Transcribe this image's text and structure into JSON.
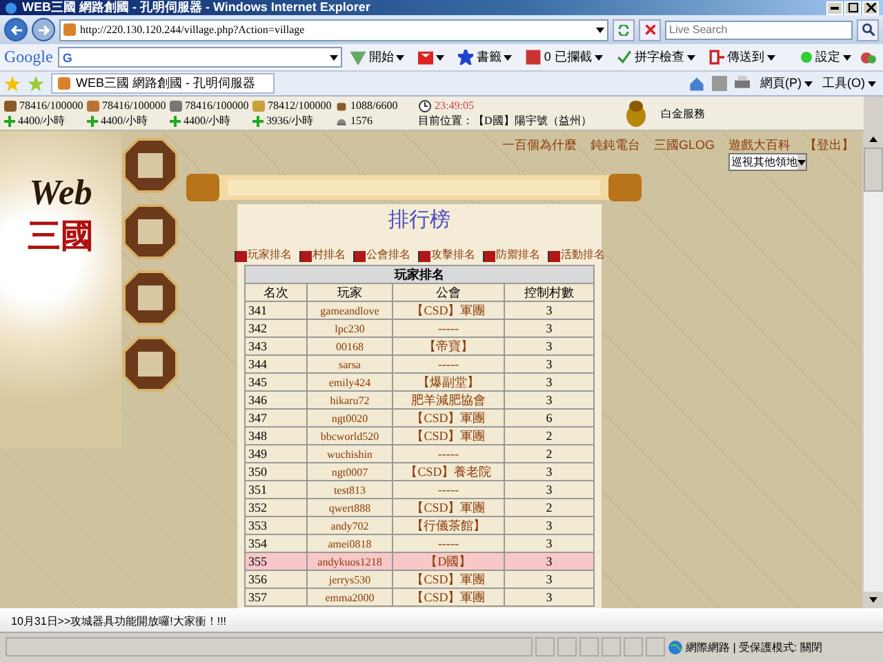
{
  "window": {
    "title": "WEB三國 網路創國 - 孔明伺服器 - Windows Internet Explorer"
  },
  "address_bar": {
    "url": "http://220.130.120.244/village.php?Action=village"
  },
  "search": {
    "placeholder": "Live Search"
  },
  "google_toolbar": {
    "logo": "Google",
    "search_label": "G",
    "items": [
      {
        "kind": "go",
        "label": "開始"
      },
      {
        "kind": "mail"
      },
      {
        "kind": "star",
        "label": "書籤"
      },
      {
        "kind": "popup",
        "label": "0 已攔截"
      },
      {
        "kind": "spell",
        "label": "拼字檢查"
      },
      {
        "kind": "send",
        "label": "傳送到"
      }
    ],
    "settings": "設定"
  },
  "tab_bar": {
    "tabs": [
      {
        "label": "WEB三國 網路創國 - 孔明伺服器"
      }
    ],
    "tools": [
      "網頁(P)",
      "工具(O)"
    ]
  },
  "resources": [
    {
      "kind": "wood",
      "amount": "78416/100000",
      "rate": "4400/小時"
    },
    {
      "kind": "clay",
      "amount": "78416/100000",
      "rate": "4400/小時"
    },
    {
      "kind": "iron",
      "amount": "78416/100000",
      "rate": "4400/小時"
    },
    {
      "kind": "crop",
      "amount": "78412/100000",
      "rate": "3936/小時"
    }
  ],
  "population": {
    "amount": "1088/6600",
    "value": "1576"
  },
  "clock": {
    "time": "23:49:05",
    "location": "目前位置：【D國】陽宇號（益州）"
  },
  "premium": "白金服務",
  "logo": {
    "title": "Web",
    "subtitle": "三國"
  },
  "top_links": [
    "一百個為什麼",
    "鈍鈍電台",
    "三國GLOG",
    "遊戲大百科",
    "【登出】"
  ],
  "village_select": {
    "value": "巡視其他領地"
  },
  "ranking": {
    "title": "排行榜",
    "tabs": [
      "玩家排名",
      "村排名",
      "公會排名",
      "攻擊排名",
      "防禦排名",
      "活動排名"
    ],
    "table": {
      "caption": "玩家排名",
      "columns": [
        "名次",
        "玩家",
        "公會",
        "控制村數"
      ],
      "rows": [
        {
          "cells": [
            "341",
            "gameandlove",
            "【CSD】軍團",
            "3"
          ],
          "selected": false
        },
        {
          "cells": [
            "342",
            "lpc230",
            "-----",
            "3"
          ],
          "selected": false
        },
        {
          "cells": [
            "343",
            "00168",
            "【帝寶】",
            "3"
          ],
          "selected": false
        },
        {
          "cells": [
            "344",
            "sarsa",
            "-----",
            "3"
          ],
          "selected": false
        },
        {
          "cells": [
            "345",
            "emily424",
            "【爆副堂】",
            "3"
          ],
          "selected": false
        },
        {
          "cells": [
            "346",
            "hikaru72",
            "肥羊減肥協會",
            "3"
          ],
          "selected": false
        },
        {
          "cells": [
            "347",
            "ngt0020",
            "【CSD】軍團",
            "6"
          ],
          "selected": false
        },
        {
          "cells": [
            "348",
            "bbcworld520",
            "【CSD】軍團",
            "2"
          ],
          "selected": false
        },
        {
          "cells": [
            "349",
            "wuchishin",
            "-----",
            "2"
          ],
          "selected": false
        },
        {
          "cells": [
            "350",
            "ngt0007",
            "【CSD】養老院",
            "3"
          ],
          "selected": false
        },
        {
          "cells": [
            "351",
            "test813",
            "-----",
            "3"
          ],
          "selected": false
        },
        {
          "cells": [
            "352",
            "qwert888",
            "【CSD】軍團",
            "2"
          ],
          "selected": false
        },
        {
          "cells": [
            "353",
            "andy702",
            "【行儀茶館】",
            "3"
          ],
          "selected": false
        },
        {
          "cells": [
            "354",
            "amei0818",
            "-----",
            "3"
          ],
          "selected": false
        },
        {
          "cells": [
            "355",
            "andykuos1218",
            "【D國】",
            "3"
          ],
          "selected": true
        },
        {
          "cells": [
            "356",
            "jerrys530",
            "【CSD】軍團",
            "3"
          ],
          "selected": false
        },
        {
          "cells": [
            "357",
            "emma2000",
            "【CSD】軍團",
            "3"
          ],
          "selected": false
        }
      ]
    }
  },
  "news": "10月31日>>攻城器具功能開放囉!大家衝！!!!",
  "status_bar": {
    "zone": "網際網路 | 受保護模式: 關閉"
  }
}
